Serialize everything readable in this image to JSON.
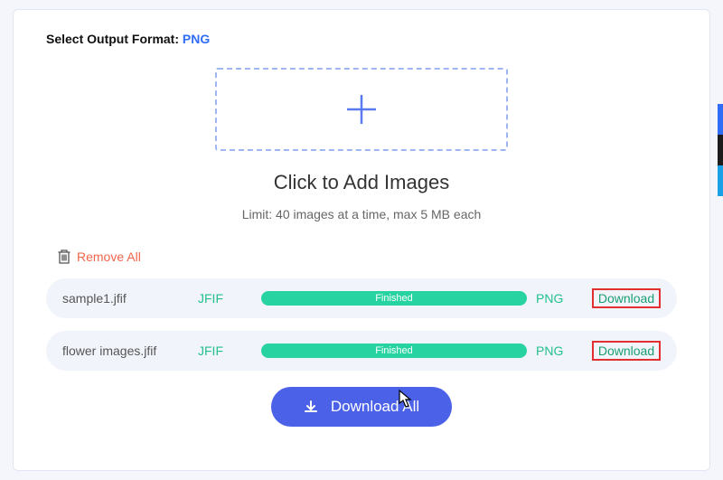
{
  "format_label": "Select Output Format: ",
  "format_value": "PNG",
  "add_images_label": "Click to Add Images",
  "limit_text": "Limit: 40 images at a time, max 5 MB each",
  "remove_all_label": "Remove All",
  "files": [
    {
      "name": "sample1.jfif",
      "src": "JFIF",
      "status": "Finished",
      "dst": "PNG",
      "action": "Download"
    },
    {
      "name": "flower images.jfif",
      "src": "JFIF",
      "status": "Finished",
      "dst": "PNG",
      "action": "Download"
    }
  ],
  "download_all_label": "Download All"
}
